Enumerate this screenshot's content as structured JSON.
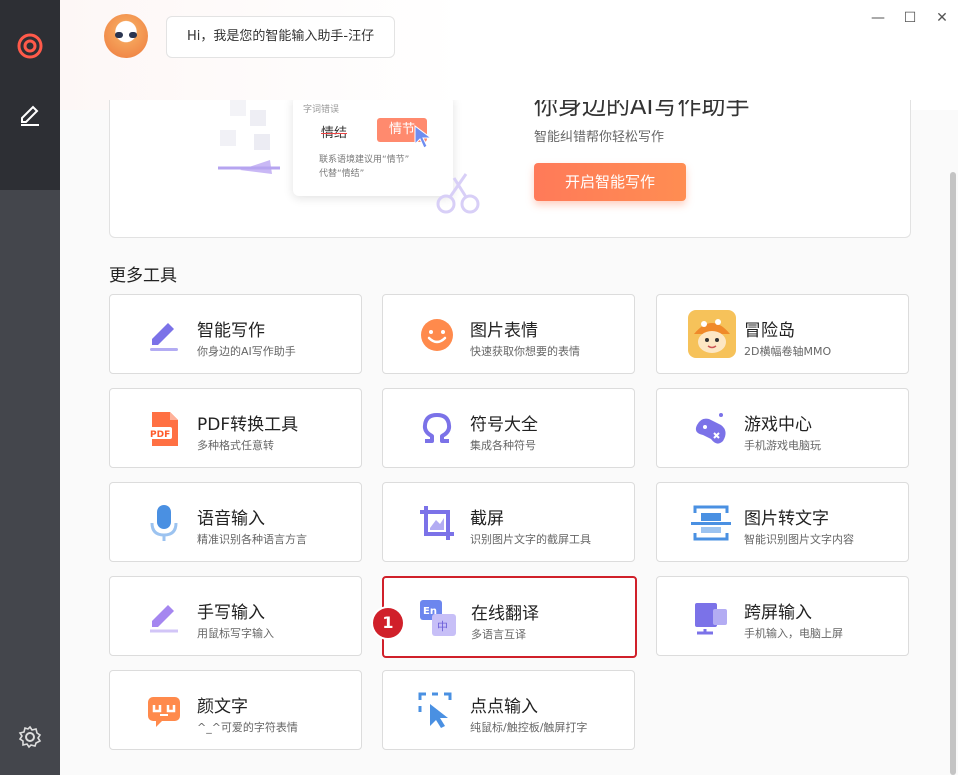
{
  "window": {
    "minimize_glyph": "—",
    "maximize_glyph": "☐",
    "close_glyph": "✕"
  },
  "greeting": {
    "text": "Hi，我是您的智能输入助手-汪仔"
  },
  "banner": {
    "headline": "你身边的AI写作助手",
    "subtitle": "智能纠错帮你轻松写作",
    "cta_label": "开启智能写作",
    "demo": {
      "tag": "字词错误",
      "wrong_word": "情结",
      "correct_word": "情节",
      "suggestion_line1": "联系语境建议用“情节”",
      "suggestion_line2": "代替“情结”"
    }
  },
  "section": {
    "title": "更多工具"
  },
  "tools": [
    {
      "name": "智能写作",
      "desc": "你身边的AI写作助手",
      "icon": "pen-write-icon"
    },
    {
      "name": "图片表情",
      "desc": "快速获取你想要的表情",
      "icon": "smiley-icon"
    },
    {
      "name": "冒险岛",
      "desc": "2D横幅卷轴MMO",
      "icon": "mushroom-game-icon"
    },
    {
      "name": "PDF转换工具",
      "desc": "多种格式任意转",
      "icon": "pdf-icon"
    },
    {
      "name": "符号大全",
      "desc": "集成各种符号",
      "icon": "omega-icon"
    },
    {
      "name": "游戏中心",
      "desc": "手机游戏电脑玩",
      "icon": "gamepad-icon"
    },
    {
      "name": "语音输入",
      "desc": "精准识别各种语言方言",
      "icon": "microphone-icon"
    },
    {
      "name": "截屏",
      "desc": "识别图片文字的截屏工具",
      "icon": "screenshot-icon"
    },
    {
      "name": "图片转文字",
      "desc": "智能识别图片文字内容",
      "icon": "ocr-icon"
    },
    {
      "name": "手写输入",
      "desc": "用鼠标写字输入",
      "icon": "handwriting-icon"
    },
    {
      "name": "在线翻译",
      "desc": "多语言互译",
      "icon": "translate-icon"
    },
    {
      "name": "跨屏输入",
      "desc": "手机输入，电脑上屏",
      "icon": "cross-screen-icon"
    },
    {
      "name": "颜文字",
      "desc": "^_^可爱的字符表情",
      "icon": "kaomoji-icon"
    },
    {
      "name": "点点输入",
      "desc": "纯鼠标/触控板/触屏打字",
      "icon": "click-input-icon"
    }
  ],
  "step_marker": {
    "label": "1"
  },
  "colors": {
    "accent_orange": "#ff7a59",
    "highlight_red": "#d0202a",
    "icon_purple": "#7b72e8",
    "icon_blue": "#4a90e2"
  }
}
